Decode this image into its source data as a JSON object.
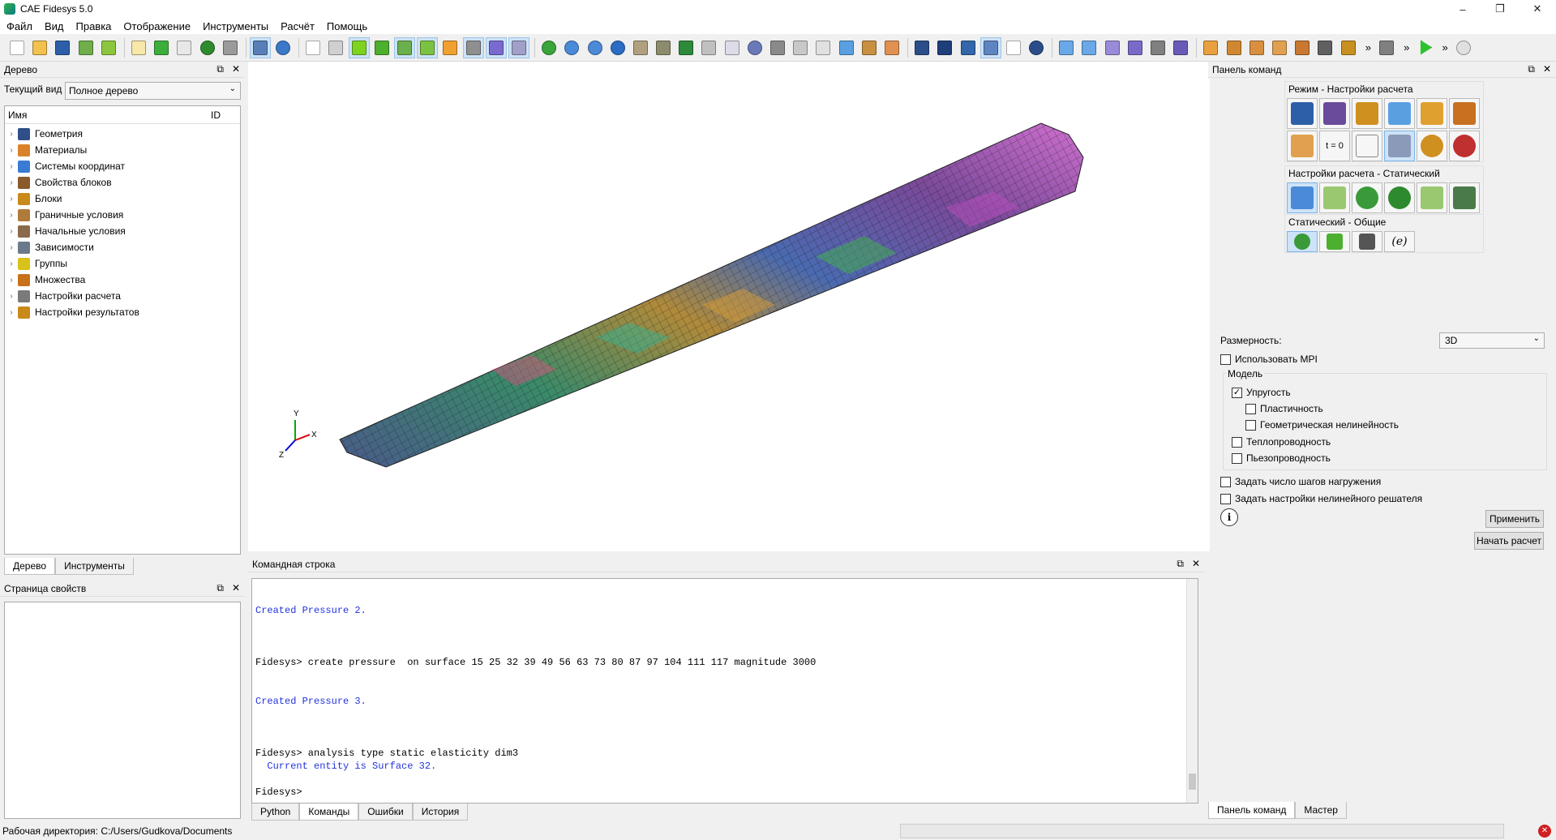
{
  "window": {
    "title": "CAE Fidesys 5.0",
    "minimize": "–",
    "maximize": "❐",
    "close": "✕"
  },
  "menu": [
    "Файл",
    "Вид",
    "Правка",
    "Отображение",
    "Инструменты",
    "Расчёт",
    "Помощь"
  ],
  "toolbar": {
    "more_marker_1": "»",
    "more_marker_2": "»",
    "more_marker_3": "»"
  },
  "tree_panel": {
    "title": "Дерево",
    "current_view_label": "Текущий вид",
    "current_view_value": "Полное дерево",
    "col_name": "Имя",
    "col_id": "ID",
    "items": [
      {
        "label": "Геометрия",
        "icon": "geometry-icon",
        "color": "#2f4f8a"
      },
      {
        "label": "Материалы",
        "icon": "materials-icon",
        "color": "#d9822b"
      },
      {
        "label": "Системы координат",
        "icon": "coordinate-system-icon",
        "color": "#3a7bd5"
      },
      {
        "label": "Свойства блоков",
        "icon": "block-properties-icon",
        "color": "#8a5a2b"
      },
      {
        "label": "Блоки",
        "icon": "blocks-icon",
        "color": "#c98a1b"
      },
      {
        "label": "Граничные условия",
        "icon": "boundary-conditions-icon",
        "color": "#b07a3a"
      },
      {
        "label": "Начальные условия",
        "icon": "initial-conditions-icon",
        "color": "#8a6a4a"
      },
      {
        "label": "Зависимости",
        "icon": "dependencies-icon",
        "color": "#6a7a8a"
      },
      {
        "label": "Группы",
        "icon": "groups-icon",
        "color": "#d8c21b"
      },
      {
        "label": "Множества",
        "icon": "sets-icon",
        "color": "#c9701b"
      },
      {
        "label": "Настройки расчета",
        "icon": "analysis-settings-icon",
        "color": "#7a7a7a"
      },
      {
        "label": "Настройки результатов",
        "icon": "results-settings-icon",
        "color": "#c98a1b"
      }
    ],
    "tabs": [
      "Дерево",
      "Инструменты"
    ]
  },
  "properties_panel": {
    "title": "Страница свойств"
  },
  "command_line": {
    "title": "Командная строка",
    "lines": [
      {
        "text": "Created Pressure 2.",
        "kind": "output"
      },
      {
        "text": "Fidesys> create pressure  on surface 15 25 32 39 49 56 63 73 80 87 97 104 111 117 magnitude 3000",
        "kind": "command"
      },
      {
        "text": "Created Pressure 3.",
        "kind": "output"
      },
      {
        "text": "Fidesys> analysis type static elasticity dim3",
        "kind": "command"
      },
      {
        "text": "  Current entity is Surface 32.",
        "kind": "output"
      },
      {
        "text": "Fidesys> ",
        "kind": "command"
      }
    ],
    "tabs": [
      "Python",
      "Команды",
      "Ошибки",
      "История"
    ]
  },
  "command_panel": {
    "title": "Панель команд",
    "mode_group": "Режим - Настройки расчета",
    "static_group": "Настройки расчета - Статический",
    "general_group": "Статический - Общие",
    "general_fourth_button": "(e)",
    "t0_button": "t = 0",
    "dimension_label": "Размерность:",
    "dimension_value": "3D",
    "use_mpi": "Использовать MPI",
    "model_label": "Модель",
    "elasticity": "Упругость",
    "plasticity": "Пластичность",
    "geometric_nonlinearity": "Геометрическая нелинейность",
    "heat_conduction": "Теплопроводность",
    "piezo": "Пьезопроводность",
    "load_steps": "Задать число шагов нагружения",
    "nonlinear_solver": "Задать настройки нелинейного решателя",
    "info_button": "i",
    "apply_button": "Применить",
    "start_button": "Начать расчет",
    "tabs": [
      "Панель команд",
      "Мастер"
    ]
  },
  "viewport": {
    "axis_x": "X",
    "axis_y": "Y",
    "axis_z": "Z"
  },
  "status": {
    "working_dir": "Рабочая директория: C:/Users/Gudkova/Documents"
  },
  "colors": {
    "accent_selected": "#cde3f7",
    "output_text": "#2233dd"
  }
}
